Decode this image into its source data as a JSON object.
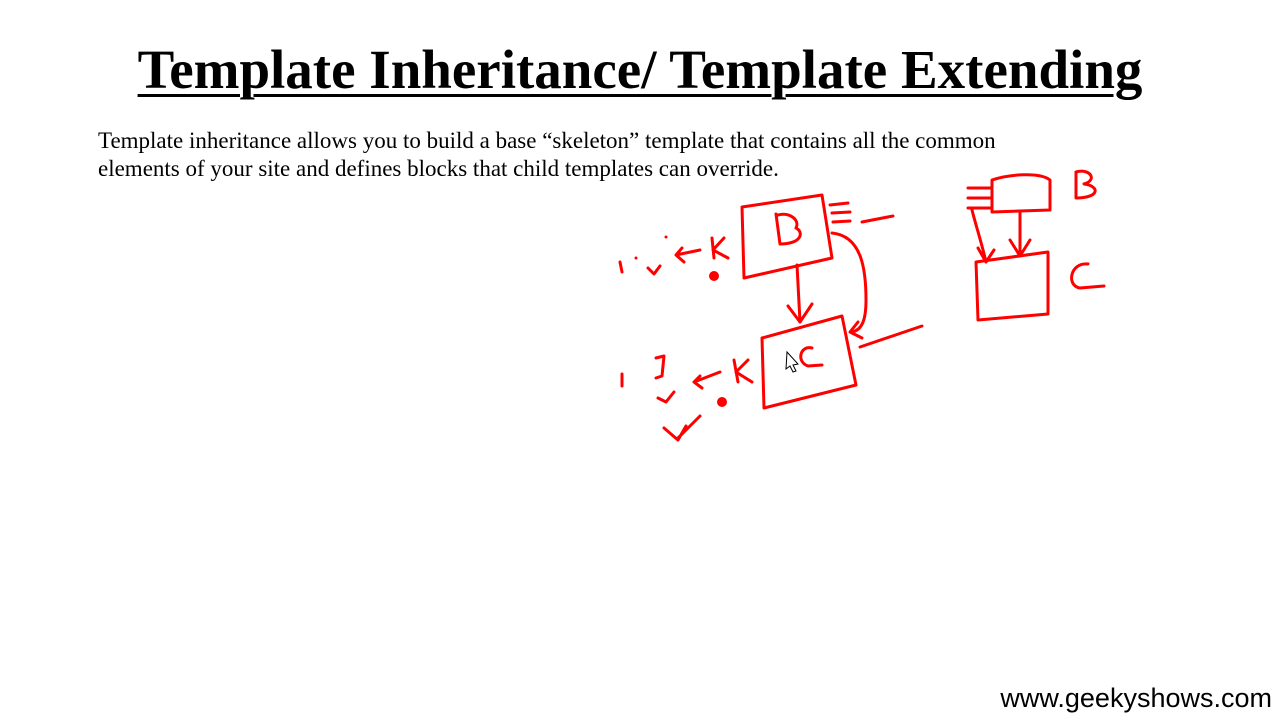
{
  "slide": {
    "title": "Template Inheritance/ Template Extending",
    "body_lines": [
      "Template inheritance allows you to build a base “skeleton” template that contains all the common",
      "elements of your site and defines blocks that child templates can override."
    ],
    "footer": "www.geekyshows.com"
  },
  "annotation": {
    "color": "#ff0000",
    "icons": [
      "freehand-diagram",
      "cursor-pointer-icon"
    ]
  }
}
